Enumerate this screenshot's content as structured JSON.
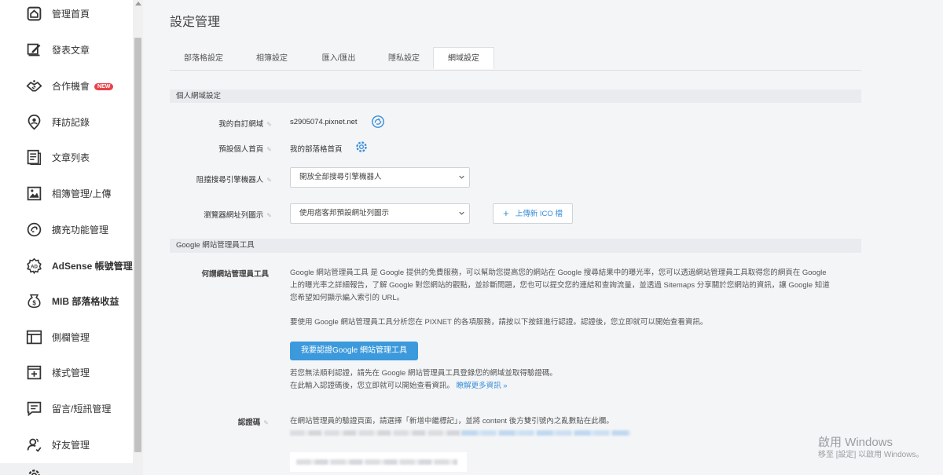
{
  "sidebar": {
    "items": [
      {
        "label": "管理首頁",
        "icon": "home-icon"
      },
      {
        "label": "發表文章",
        "icon": "edit-icon"
      },
      {
        "label": "合作機會",
        "icon": "handshake-icon",
        "badge": "NEW"
      },
      {
        "label": "拜訪記錄",
        "icon": "location-person-icon"
      },
      {
        "label": "文章列表",
        "icon": "document-list-icon"
      },
      {
        "label": "相簿管理/上傳",
        "icon": "image-icon"
      },
      {
        "label": "擴充功能管理",
        "icon": "plugin-icon"
      },
      {
        "label": "AdSense 帳號管理",
        "icon": "adsense-icon"
      },
      {
        "label": "MIB 部落格收益",
        "icon": "revenue-icon"
      },
      {
        "label": "側欄管理",
        "icon": "sidebar-layout-icon"
      },
      {
        "label": "樣式管理",
        "icon": "style-add-icon"
      },
      {
        "label": "留言/短訊管理",
        "icon": "message-icon"
      },
      {
        "label": "好友管理",
        "icon": "friends-icon"
      }
    ]
  },
  "page": {
    "title": "設定管理"
  },
  "tabs": [
    {
      "label": "部落格設定"
    },
    {
      "label": "相簿設定"
    },
    {
      "label": "匯入/匯出"
    },
    {
      "label": "隱私設定"
    },
    {
      "label": "網域設定",
      "active": true
    }
  ],
  "personal_domain": {
    "section_title": "個人網域設定",
    "custom_domain_label": "我的自訂網域",
    "custom_domain_value": "s2905074.pixnet.net",
    "default_home_label": "預設個人首頁",
    "default_home_value": "我的部落格首頁",
    "block_robots_label": "阻擋搜尋引擎機器人",
    "block_robots_value": "開放全部搜尋引擎機器人",
    "favicon_label": "瀏覽器網址列圖示",
    "favicon_value": "使用痞客邦預設網址列圖示",
    "upload_button": "上傳新 ICO 檔"
  },
  "google": {
    "section_title": "Google 網站管理員工具",
    "what_label": "何謂網站管理員工具",
    "desc_line1": "Google 網站管理員工具 是 Google 提供的免費服務，可以幫助您提高您的網站在 Google 搜尋結果中的曝光率，您可以透過網站管理員工具取得您的網頁在 Google",
    "desc_line2": "上的曝光率之詳細報告，了解 Google 對您網站的觀點，並診斷問題，您也可以提交您的連結和查詢流量，並透過 Sitemaps 分享關於您網站的資訊，讓 Google 知道",
    "desc_line3": "您希望如何顯示編入索引的 URL。",
    "usage_text": "要使用 Google 網站管理員工具分析您在 PIXNET 的各項服務，請按以下按鈕進行認證。認證後，您立即就可以開始查看資訊。",
    "verify_button": "我要認證Google 網站管理工具",
    "fail_line1": "若您無法順利認證，請先在 Google 網站管理員工具登錄您的網域並取得驗證碼。",
    "fail_line2": "在此輸入認證碼後，您立即就可以開始查看資訊。",
    "learn_more": "瞭解更多資訊 »",
    "code_label": "認證碼",
    "code_help": "在網站管理員的驗證頁面，請選擇「新增中繼標記」，並將 content 後方雙引號內之亂數貼在此欄。"
  },
  "watermark": {
    "line1": "啟用 Windows",
    "line2": "移至 [設定] 以啟用 Windows。"
  }
}
